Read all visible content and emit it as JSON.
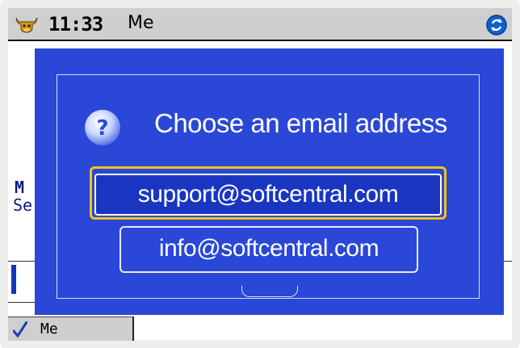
{
  "status_bar": {
    "time": "11:33",
    "profile": "Me",
    "app_icon": "bull-icon",
    "sync_icon": "sync-icon"
  },
  "background": {
    "fragment_m": "M",
    "fragment_se": "Se"
  },
  "dialog": {
    "icon": "question-icon",
    "title": "Choose an email address",
    "options": [
      {
        "label": "support@softcentral.com",
        "selected": true
      },
      {
        "label": "info@softcentral.com",
        "selected": false
      }
    ]
  },
  "bottom_tab": {
    "icon": "check-icon",
    "label": "Me"
  },
  "colors": {
    "dialog_bg": "#2a47d7",
    "focus_border": "#f4c414",
    "status_bar_bg": "#cfcfcf"
  }
}
